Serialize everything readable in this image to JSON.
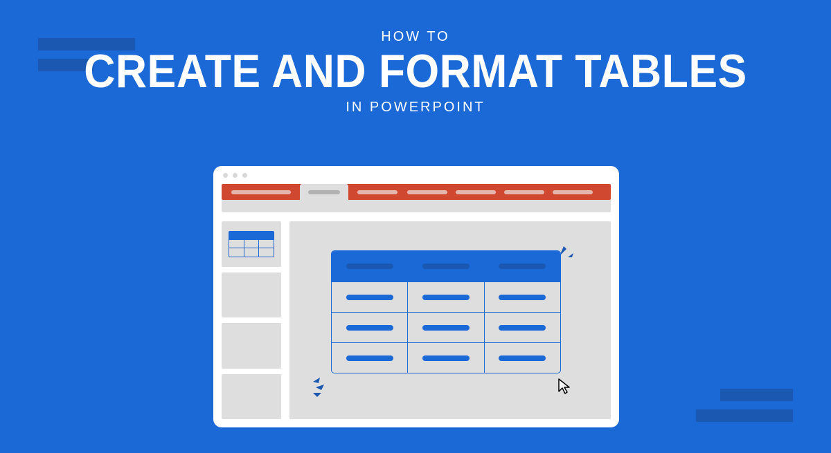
{
  "heading": {
    "eyebrow": "HOW TO",
    "title": "CREATE AND FORMAT TABLES",
    "subtitle": "IN POWERPOINT"
  }
}
